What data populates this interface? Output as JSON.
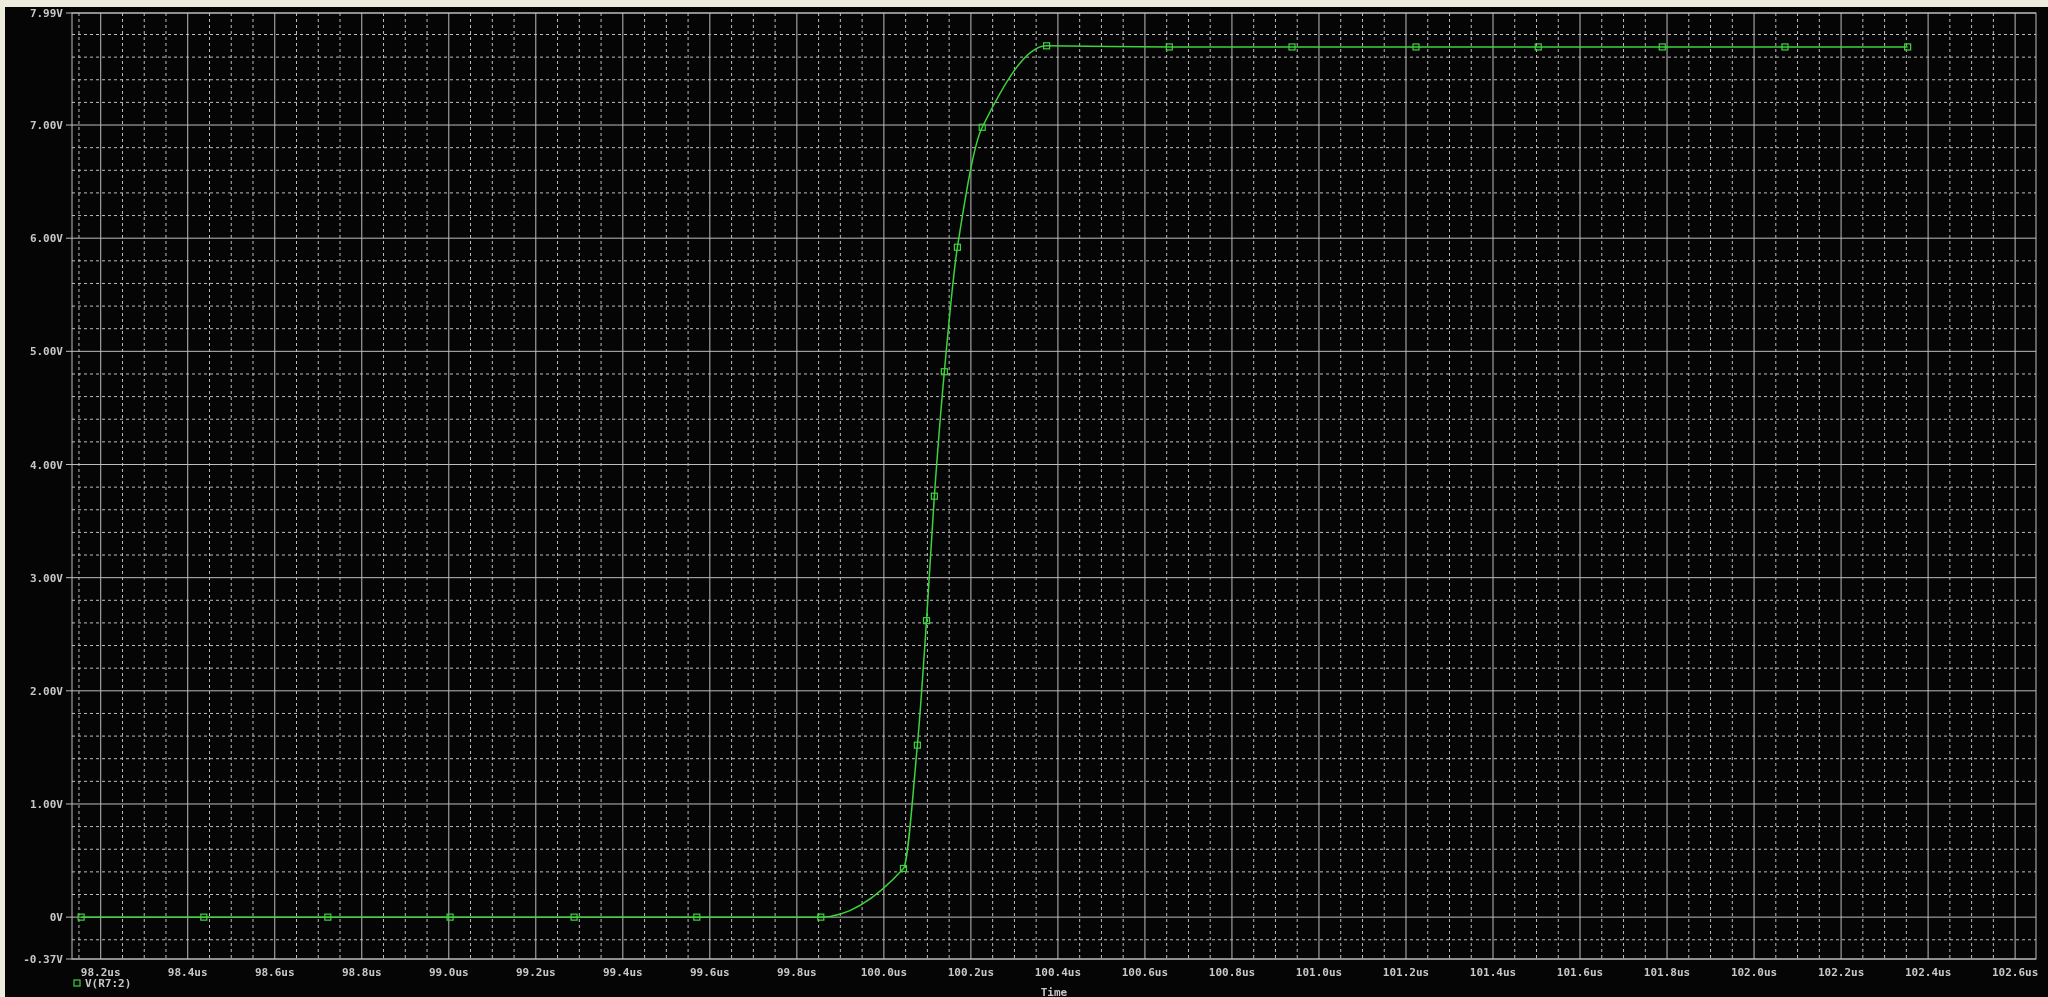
{
  "plot": {
    "chart_data": {
      "type": "line",
      "grid": true,
      "marker": "square",
      "xlabel": "Time",
      "xlim": [
        98.134,
        102.648
      ],
      "ylim": [
        -0.37,
        7.99
      ],
      "xticks": [
        {
          "value": 98.2,
          "label": "98.2us"
        },
        {
          "value": 98.4,
          "label": "98.4us"
        },
        {
          "value": 98.6,
          "label": "98.6us"
        },
        {
          "value": 98.8,
          "label": "98.8us"
        },
        {
          "value": 99.0,
          "label": "99.0us"
        },
        {
          "value": 99.2,
          "label": "99.2us"
        },
        {
          "value": 99.4,
          "label": "99.4us"
        },
        {
          "value": 99.6,
          "label": "99.6us"
        },
        {
          "value": 99.8,
          "label": "99.8us"
        },
        {
          "value": 100.0,
          "label": "100.0us"
        },
        {
          "value": 100.2,
          "label": "100.2us"
        },
        {
          "value": 100.4,
          "label": "100.4us"
        },
        {
          "value": 100.6,
          "label": "100.6us"
        },
        {
          "value": 100.8,
          "label": "100.8us"
        },
        {
          "value": 101.0,
          "label": "101.0us"
        },
        {
          "value": 101.2,
          "label": "101.2us"
        },
        {
          "value": 101.4,
          "label": "101.4us"
        },
        {
          "value": 101.6,
          "label": "101.6us"
        },
        {
          "value": 101.8,
          "label": "101.8us"
        },
        {
          "value": 102.0,
          "label": "102.0us"
        },
        {
          "value": 102.2,
          "label": "102.2us"
        },
        {
          "value": 102.4,
          "label": "102.4us"
        },
        {
          "value": 102.6,
          "label": "102.6us"
        }
      ],
      "yticks": [
        {
          "value": -0.37,
          "label": "-0.37V"
        },
        {
          "value": 0,
          "label": "0V"
        },
        {
          "value": 1,
          "label": "1.00V"
        },
        {
          "value": 2,
          "label": "2.00V"
        },
        {
          "value": 3,
          "label": "3.00V"
        },
        {
          "value": 4,
          "label": "4.00V"
        },
        {
          "value": 5,
          "label": "5.00V"
        },
        {
          "value": 6,
          "label": "6.00V"
        },
        {
          "value": 7,
          "label": "7.00V"
        },
        {
          "value": 7.99,
          "label": "7.99V"
        }
      ],
      "x": [
        98.155,
        98.437,
        98.722,
        99.003,
        99.288,
        99.57,
        99.855,
        100.045,
        100.077,
        100.098,
        100.116,
        100.139,
        100.169,
        100.226,
        100.374,
        100.656,
        100.938,
        101.223,
        101.504,
        101.789,
        102.071,
        102.353
      ],
      "series": [
        {
          "name": "V(R7:2)",
          "color": "#3cd43c",
          "values": [
            0,
            0,
            0,
            0,
            0,
            0,
            0,
            0.43,
            1.52,
            2.62,
            3.72,
            4.82,
            5.92,
            6.98,
            7.7,
            7.69,
            7.69,
            7.69,
            7.69,
            7.69,
            7.69,
            7.69
          ]
        }
      ]
    }
  }
}
